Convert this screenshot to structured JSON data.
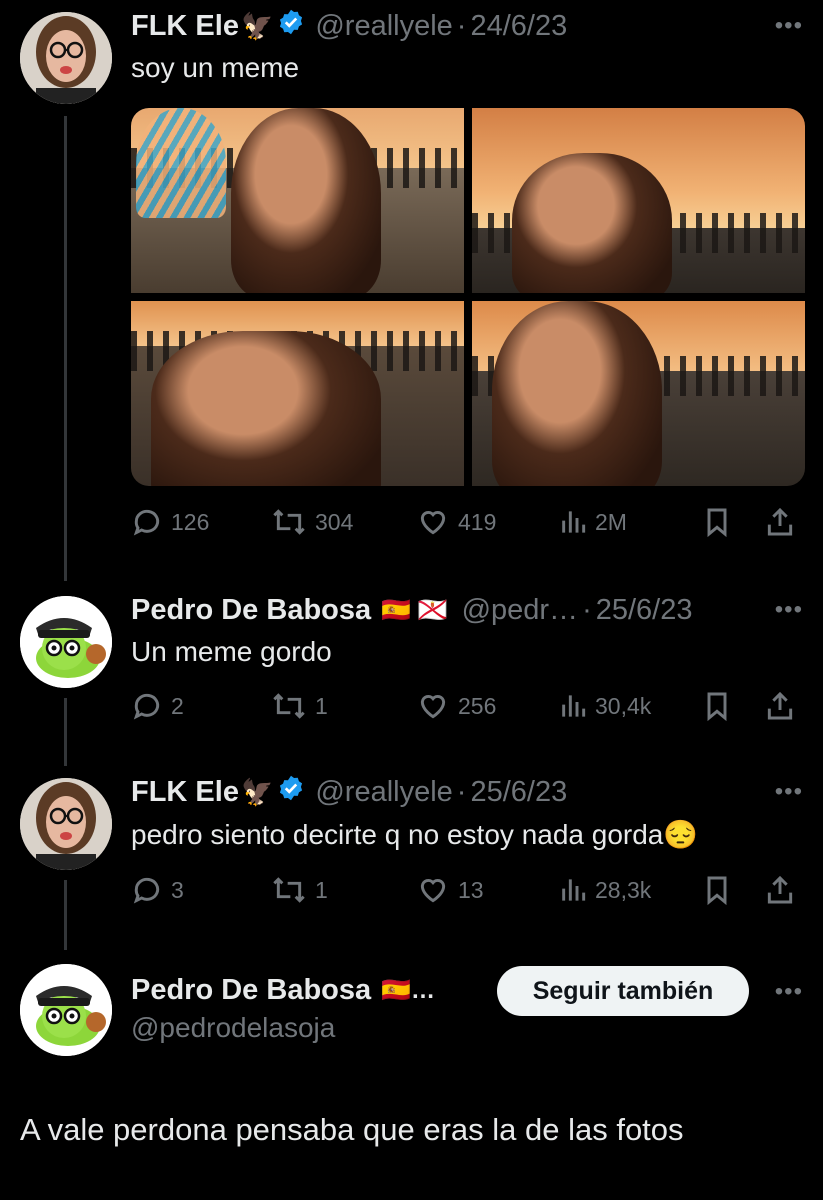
{
  "tweets": [
    {
      "name": "FLK Ele",
      "name_emoji": "🦅",
      "verified": true,
      "handle": "@reallyele",
      "sep": "·",
      "date": "24/6/23",
      "text": "soy un meme",
      "actions": {
        "replies": "126",
        "reposts": "304",
        "likes": "419",
        "views": "2M"
      }
    },
    {
      "name": "Pedro De Babosa",
      "flags": "🇪🇸 🇯🇪",
      "handle": "@pedr…",
      "sep": "·",
      "date": "25/6/23",
      "text": "Un meme gordo",
      "actions": {
        "replies": "2",
        "reposts": "1",
        "likes": "256",
        "views": "30,4k"
      }
    },
    {
      "name": "FLK Ele",
      "name_emoji": "🦅",
      "verified": true,
      "handle": "@reallyele",
      "sep": "·",
      "date": "25/6/23",
      "text": "pedro siento decirte q no estoy nada gorda😔",
      "actions": {
        "replies": "3",
        "reposts": "1",
        "likes": "13",
        "views": "28,3k"
      }
    }
  ],
  "focused": {
    "name": "Pedro De Babosa",
    "flags": "🇪🇸…",
    "handle": "@pedrodelasoja",
    "follow_label": "Seguir también",
    "text": "A vale perdona pensaba que eras la de las fotos"
  },
  "more_icon": "more-dots-icon",
  "colors": {
    "background": "#000000",
    "muted": "#71767b",
    "verified": "#1d9bf0",
    "text": "#e7e9ea"
  }
}
